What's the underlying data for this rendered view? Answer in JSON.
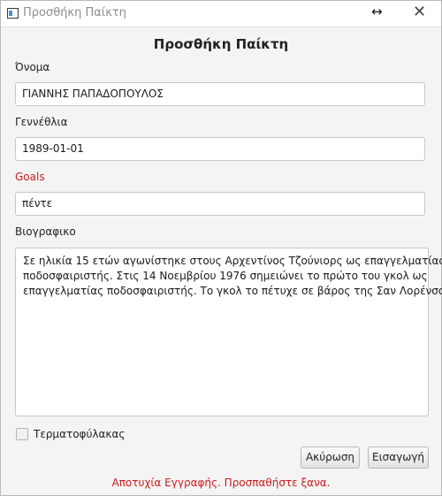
{
  "window": {
    "title": "Προσθήκη Παίκτη",
    "app_icon": "window-app-icon",
    "resize_glyph": "↔",
    "close_glyph": "✕"
  },
  "form": {
    "heading": "Προσθήκη Παίκτη",
    "name": {
      "label": "Όνομα",
      "value": "ΓΙΑΝΝΗΣ ΠΑΠΑΔΟΠΟΥΛΟΣ"
    },
    "birthdate": {
      "label": "Γεννέθλια",
      "value": "1989-01-01"
    },
    "goals": {
      "label": "Goals",
      "value": "πέντε",
      "label_color": "#cc1d1d"
    },
    "bio": {
      "label": "Βιογραφικο",
      "lines": [
        "Σε ηλικία 15 ετών αγωνίστηκε στους Αρχεντίνος Τζούνιορς ως επαγγελματίας",
        " ποδοσφαιριστής. Στις 14 Νοεμβρίου 1976 σημειώνει το πρώτο του γκολ ως",
        " επαγγελματίας ποδοσφαιριστής. Το γκολ το πέτυχε σε βάρος της Σαν Λορένσο."
      ]
    },
    "goalkeeper": {
      "label": "Τερματοφύλακας",
      "checked": false
    }
  },
  "buttons": {
    "cancel": "Ακύρωση",
    "insert": "Εισαγωγή"
  },
  "status": {
    "message": "Αποτυχία Εγγραφής. Προσπαθήστε ξανα.",
    "color": "#cc1d1d"
  }
}
